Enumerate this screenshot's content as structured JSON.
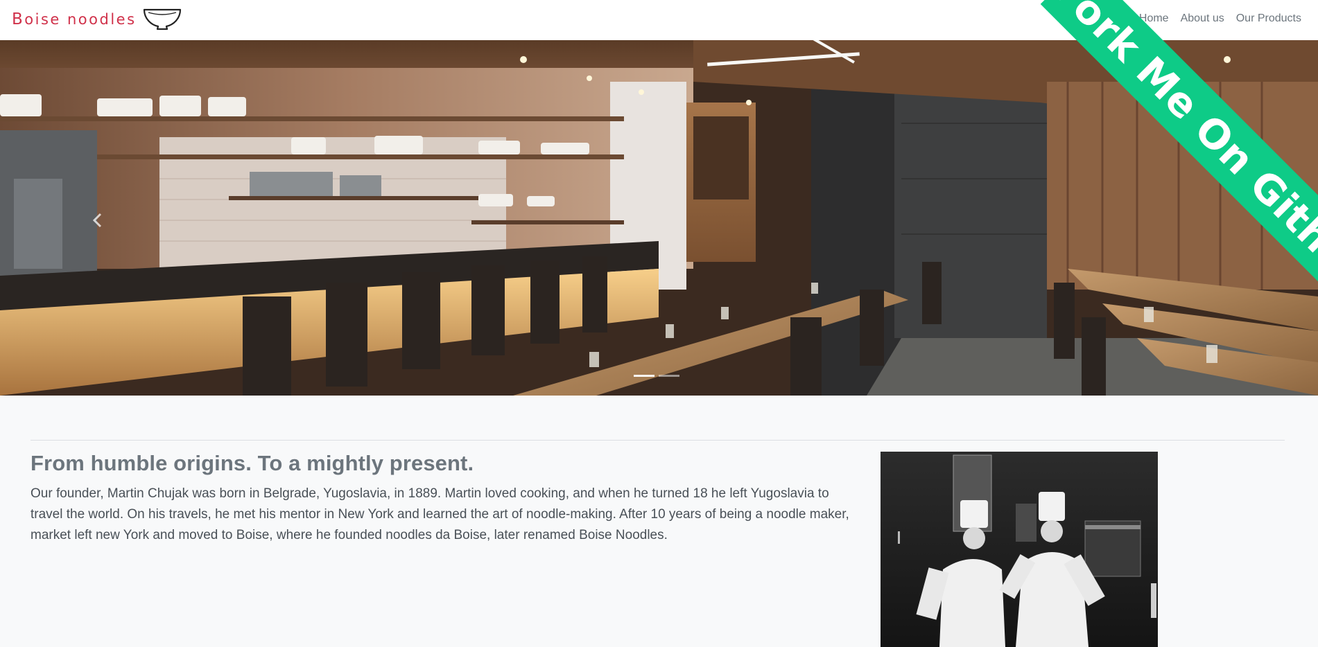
{
  "navbar": {
    "brand": "Boise noodles",
    "brand_first_letter": "B",
    "brand_rest": "oise noodles",
    "brand_icon": "noodle-bowl-icon",
    "links": [
      {
        "label": "Home"
      },
      {
        "label": "About us"
      },
      {
        "label": "Our Products"
      }
    ]
  },
  "ribbon": {
    "label": "Fork Me On Github",
    "color": "#0ecb87"
  },
  "hero": {
    "image": "restaurant-interior",
    "prev_icon": "chevron-left-icon",
    "slide_count": 2,
    "active_slide": 1
  },
  "about": {
    "headline": "From humble origins. To a mightly present.",
    "body": "Our founder, Martin Chujak was born in Belgrade, Yugoslavia, in 1889. Martin loved cooking, and when he turned 18 he left Yugoslavia to travel the world. On his travels, he met his mentor in New York and learned the art of noodle-making. After 10 years of being a noodle maker, market left new York and moved to Boise, where he founded noodles da Boise, later renamed Boise Noodles.",
    "photo": "founders-black-and-white-photo"
  },
  "colors": {
    "brand": "#d0314a",
    "nav_link": "#6c757d",
    "page_background": "#f8f9fa",
    "ribbon": "#0ecb87"
  }
}
